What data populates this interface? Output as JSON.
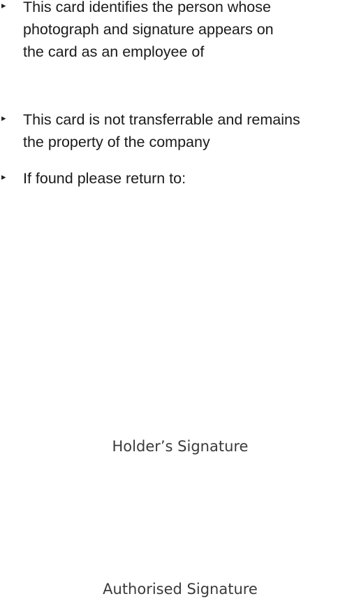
{
  "card_back": {
    "bullets": [
      "This card identifies the person whose\nphotograph and signature appears on\nthe card as an employee of",
      "This card is not transferrable and remains\nthe property of the company",
      "If found please return to:"
    ],
    "bullet_glyph": "chevron-right-icon",
    "holder_signature_label": "Holder’s Signature",
    "authorised_signature_label": "Authorised Signature"
  }
}
